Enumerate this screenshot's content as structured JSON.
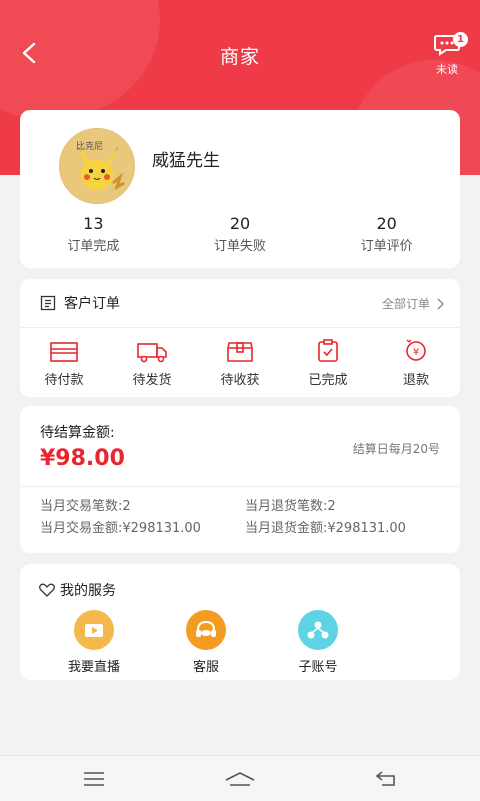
{
  "header": {
    "title": "商家",
    "unread_count": "1",
    "unread_label": "未读"
  },
  "colors": {
    "brand_red": "#ef3b47",
    "amount_red": "#e8262f"
  },
  "profile": {
    "avatar_icon": "pikachu-avatar",
    "name": "威猛先生",
    "stats": [
      {
        "value": "13",
        "label": "订单完成"
      },
      {
        "value": "20",
        "label": "订单失败"
      },
      {
        "value": "20",
        "label": "订单评价"
      }
    ]
  },
  "orders": {
    "title": "客户订单",
    "all_label": "全部订单",
    "items": [
      {
        "icon": "card-icon",
        "label": "待付款"
      },
      {
        "icon": "truck-icon",
        "label": "待发货"
      },
      {
        "icon": "box-icon",
        "label": "待收获"
      },
      {
        "icon": "clipboard-icon",
        "label": "已完成"
      },
      {
        "icon": "refund-icon",
        "label": "退款"
      }
    ]
  },
  "settlement": {
    "label": "待结算金额:",
    "amount": "¥98.00",
    "settle_day": "结算日每月20号",
    "month_trade_count": "当月交易笔数:2",
    "month_return_count": "当月退货笔数:2",
    "month_trade_amount": "当月交易金额:¥298131.00",
    "month_return_amount": "当月退货金额:¥298131.00"
  },
  "services": {
    "title": "我的服务",
    "items": [
      {
        "icon": "live-icon",
        "label": "我要直播",
        "color": "#f5b84a"
      },
      {
        "icon": "headset-icon",
        "label": "客服",
        "color": "#f39c21"
      },
      {
        "icon": "sub-account-icon",
        "label": "子账号",
        "color": "#5fd3e6"
      }
    ]
  }
}
